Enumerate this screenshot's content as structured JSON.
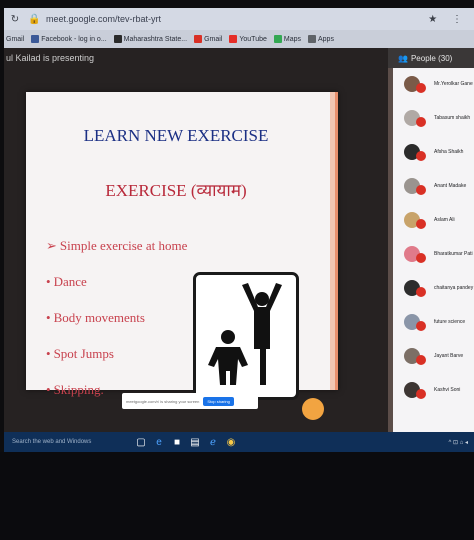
{
  "browser": {
    "url": "meet.google.com/tev-rbat-yrt",
    "top_icons": [
      "circle-icon",
      "info-icon"
    ],
    "right_icons": "★ ⋮"
  },
  "bookmarks": [
    {
      "label": "Gmail",
      "color": "#ffffff"
    },
    {
      "label": "Facebook - log in o...",
      "color": "#3b5998"
    },
    {
      "label": "Maharashtra State...",
      "color": "#2b2b2b"
    },
    {
      "label": "Gmail",
      "color": "#d93025"
    },
    {
      "label": "YouTube",
      "color": "#e52d27"
    },
    {
      "label": "Maps",
      "color": "#34a853"
    },
    {
      "label": "Apps",
      "color": "#5f6368"
    }
  ],
  "meet": {
    "presenting_text": "ul Kailad is presenting"
  },
  "slide": {
    "title": "LEARN NEW EXERCISE",
    "subtitle": "EXERCISE (व्यायाम)",
    "bullets": [
      {
        "marker": "➢",
        "text": "Simple exercise at home"
      },
      {
        "marker": "•",
        "text": "Dance"
      },
      {
        "marker": "•",
        "text": "Body movements"
      },
      {
        "marker": "•",
        "text": "Spot Jumps"
      },
      {
        "marker": "•",
        "text": "Skipping."
      }
    ]
  },
  "captions": {
    "text": "meetgoogle.com/r/ is sharing your screen",
    "stop_label": "Stop sharing"
  },
  "people": {
    "header": "People (30)",
    "list": [
      {
        "name": "Mr.Yerolkar Gane",
        "avatar_color": "#7a5a48"
      },
      {
        "name": "Tabasum shaikh",
        "avatar_color": "#b0a9a5"
      },
      {
        "name": "Afsha Shaikh",
        "avatar_color": "#2b2b2b"
      },
      {
        "name": "Anant Madake",
        "avatar_color": "#9a948f"
      },
      {
        "name": "Aslam Ali",
        "avatar_color": "#c8a36a"
      },
      {
        "name": "Bharatkumar Pati",
        "avatar_color": "#e07a8a"
      },
      {
        "name": "chaitanya pandey",
        "avatar_color": "#2d2d2d"
      },
      {
        "name": "future science",
        "avatar_color": "#8a95a8"
      },
      {
        "name": "Jayant Barve",
        "avatar_color": "#7c6f66"
      },
      {
        "name": "Kashvi Soni",
        "avatar_color": "#3d3633"
      }
    ]
  },
  "taskbar": {
    "search_text": "Search the web and Windows",
    "icons": [
      "task-view-icon",
      "edge-icon",
      "store-icon",
      "files-icon",
      "ie-icon",
      "chrome-icon"
    ],
    "tray_text": "^ ⊡ ⌂ ◂"
  }
}
